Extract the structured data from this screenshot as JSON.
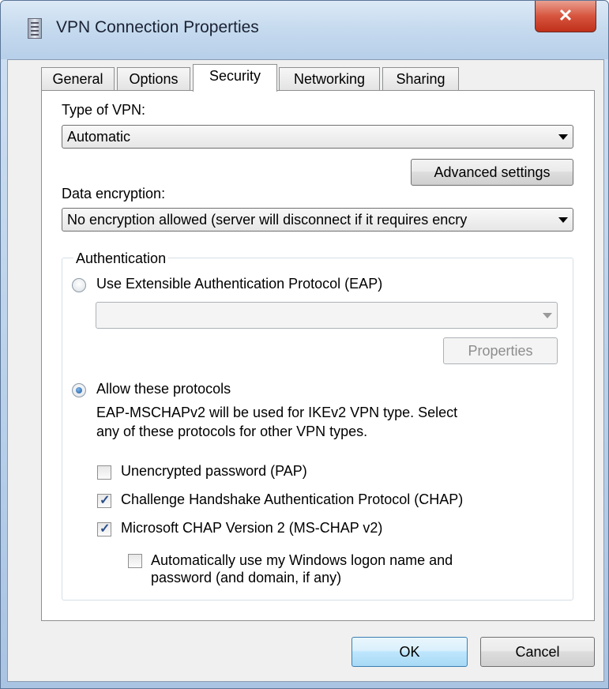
{
  "window": {
    "title": "VPN Connection Properties",
    "close_glyph": "✕"
  },
  "tabs": [
    {
      "label": "General"
    },
    {
      "label": "Options"
    },
    {
      "label": "Security"
    },
    {
      "label": "Networking"
    },
    {
      "label": "Sharing"
    }
  ],
  "active_tab": "Security",
  "security": {
    "type_of_vpn_label": "Type of VPN:",
    "type_of_vpn_value": "Automatic",
    "advanced_settings_label": "Advanced settings",
    "data_encryption_label": "Data encryption:",
    "data_encryption_value": "No encryption allowed (server will disconnect if it requires encry",
    "authentication": {
      "group_label": "Authentication",
      "eap_option_label": "Use Extensible Authentication Protocol (EAP)",
      "eap_option_selected": false,
      "eap_method_value": "",
      "eap_properties_label": "Properties",
      "allow_protocols_label": "Allow these protocols",
      "allow_protocols_selected": true,
      "description_line1": "EAP-MSCHAPv2 will be used for IKEv2 VPN type. Select",
      "description_line2": "any of these protocols for other VPN types.",
      "protocols": [
        {
          "label": "Unencrypted password (PAP)",
          "checked": false
        },
        {
          "label": "Challenge Handshake Authentication Protocol (CHAP)",
          "checked": true
        },
        {
          "label": "Microsoft CHAP Version 2 (MS-CHAP v2)",
          "checked": true
        }
      ],
      "auto_logon_line1": "Automatically use my Windows logon name and",
      "auto_logon_line2": "password (and domain, if any)",
      "auto_logon_checked": false
    }
  },
  "footer": {
    "ok_label": "OK",
    "cancel_label": "Cancel"
  },
  "icons": {
    "checkmark": "✓",
    "app_icon": "vpn-connection-icon"
  }
}
